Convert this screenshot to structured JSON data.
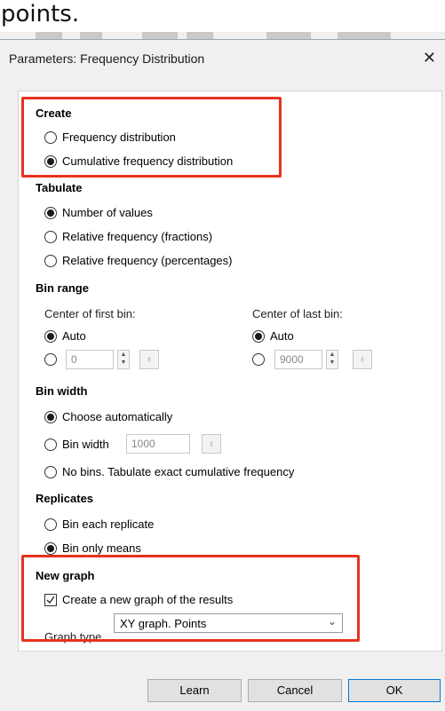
{
  "caption": "points.",
  "dialog": {
    "title": "Parameters: Frequency Distribution",
    "close_glyph": "✕"
  },
  "create": {
    "heading": "Create",
    "options": [
      {
        "label": "Frequency distribution",
        "selected": false
      },
      {
        "label": "Cumulative frequency distribution",
        "selected": true
      }
    ]
  },
  "tabulate": {
    "heading": "Tabulate",
    "options": [
      {
        "label": "Number of values",
        "selected": true
      },
      {
        "label": "Relative frequency (fractions)",
        "selected": false
      },
      {
        "label": "Relative frequency (percentages)",
        "selected": false
      }
    ]
  },
  "bin_range": {
    "heading": "Bin range",
    "first": {
      "label": "Center of first bin:",
      "auto_label": "Auto",
      "auto_selected": true,
      "value": "0"
    },
    "last": {
      "label": "Center of last bin:",
      "auto_label": "Auto",
      "auto_selected": true,
      "value": "9000"
    }
  },
  "bin_width": {
    "heading": "Bin width",
    "choose_auto_label": "Choose automatically",
    "choose_auto_selected": true,
    "bin_width_label": "Bin width",
    "bin_width_value": "1000",
    "no_bins_label": "No bins. Tabulate exact cumulative frequency"
  },
  "replicates": {
    "heading": "Replicates",
    "options": [
      {
        "label": "Bin each replicate",
        "selected": false
      },
      {
        "label": "Bin only means",
        "selected": true
      }
    ]
  },
  "new_graph": {
    "heading": "New graph",
    "create_label": "Create a new graph of the results",
    "create_checked": true,
    "graph_type_label": "Graph type",
    "graph_type_value": "XY graph. Points"
  },
  "buttons": {
    "learn": "Learn",
    "cancel": "Cancel",
    "ok": "OK"
  },
  "colors": {
    "highlight": "#e8321e",
    "dialog_bg": "#f0f0f0",
    "ok_border": "#0078d7"
  }
}
